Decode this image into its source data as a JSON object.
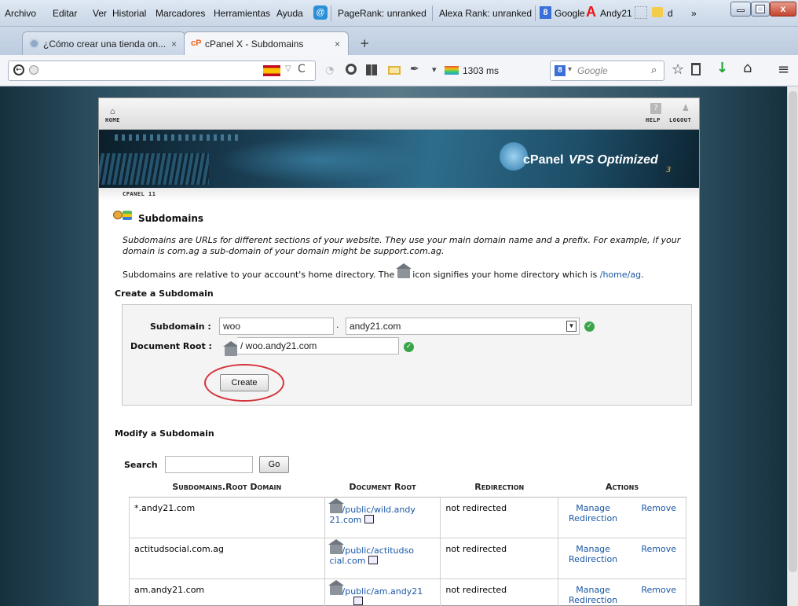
{
  "menubar": {
    "items": [
      "Archivo",
      "Editar",
      "Ver",
      "Historial",
      "Marcadores",
      "Herramientas",
      "Ayuda"
    ],
    "pagerank": "PageRank: unranked",
    "alexa": "Alexa Rank: unranked",
    "google": "Google",
    "user": "Andy21",
    "d": "d",
    "overflow": "»"
  },
  "tabs": [
    {
      "title": "¿Cómo crear una tienda on...",
      "close": "×"
    },
    {
      "title": "cPanel X - Subdomains",
      "close": "×",
      "favicon": "cP"
    }
  ],
  "newtab": "+",
  "nav": {
    "ping": "1303 ms",
    "search_placeholder": "Google"
  },
  "cpanel": {
    "home": "HOME",
    "help": "HELP",
    "logout": "LOGOUT",
    "version": "CPANEL 11",
    "brand": "cPanel",
    "brand_tail": "VPS Optimized",
    "brand_sub": "3",
    "help_icon": "?"
  },
  "content": {
    "title": "Subdomains",
    "desc": "Subdomains are URLs for different sections of your website. They use your main domain name and a prefix. For example, if your domain is com.ag a sub-domain of your domain might be support.com.ag.",
    "rel_a": "Subdomains are relative to your account's home directory. The",
    "rel_b": "icon signifies your home directory which is",
    "home_dir": "/home/ag",
    "rel_end": ".",
    "create_title": "Create a Subdomain",
    "subdomain_label": "Subdomain :",
    "subdomain_value": "woo",
    "dot": ".",
    "domain_value": "andy21.com",
    "docroot_label": "Document Root :",
    "docroot_value": "/ woo.andy21.com",
    "create_btn": "Create",
    "modify_title": "Modify a Subdomain",
    "search_label": "Search",
    "go_btn": "Go"
  },
  "table": {
    "headers": [
      "Subdomains.Root Domain",
      "Document Root",
      "Redirection",
      "Actions"
    ],
    "rows": [
      {
        "domain": "*.andy21.com",
        "docroot_a": "/public/wild.andy",
        "docroot_b": "21.com",
        "redirection": "not redirected",
        "manage": "Manage Redirection",
        "remove": "Remove"
      },
      {
        "domain": "actitudsocial.com.ag",
        "docroot_a": "/public/actitudso",
        "docroot_b": "cial.com",
        "redirection": "not redirected",
        "manage": "Manage Redirection",
        "remove": "Remove"
      },
      {
        "domain": "am.andy21.com",
        "docroot_a": "/public/am.andy21",
        "docroot_b": "",
        "redirection": "not redirected",
        "manage": "Manage Redirection",
        "remove": "Remove"
      }
    ]
  }
}
